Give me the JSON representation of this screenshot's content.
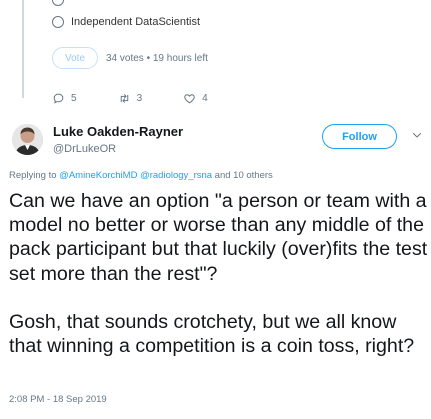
{
  "poll": {
    "options": [
      "Independent DataScientist"
    ],
    "vote_label": "Vote",
    "status": "34 votes • 19 hours left"
  },
  "actions": {
    "replies": "5",
    "retweets": "3",
    "likes": "4"
  },
  "author": {
    "name": "Luke Oakden-Rayner",
    "handle": "@DrLukeOR",
    "follow_label": "Follow"
  },
  "reply_context": {
    "prefix": "Replying to ",
    "mentions": "@AmineKorchiMD @radiology_rsna",
    "suffix": " and 10 others"
  },
  "tweet": {
    "paragraph1": "Can we have an option \"a person or team with a model no better or worse than any middle of the pack participant but that luckily (over)fits the test set more than the rest\"?",
    "paragraph2": "Gosh, that sounds crotchety, but we all know that winning a competition is a coin toss, right?",
    "timestamp": "2:08 PM - 18 Sep 2019"
  },
  "colors": {
    "accent": "#1da1f2",
    "muted": "#657786"
  }
}
